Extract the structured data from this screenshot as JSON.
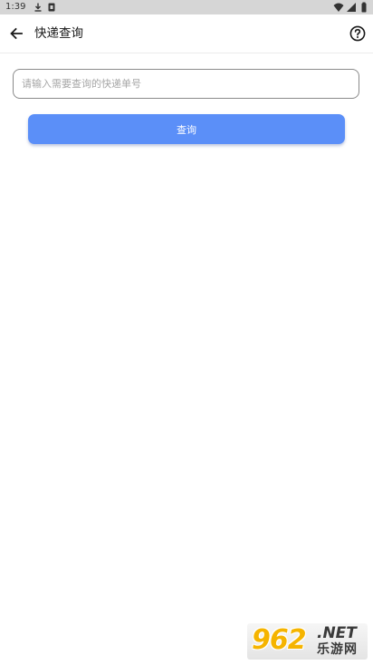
{
  "status_bar": {
    "time": "1:39",
    "icons": [
      "download-icon",
      "notification-box-icon",
      "wifi-icon",
      "cell-signal-icon",
      "battery-icon"
    ]
  },
  "app_bar": {
    "back_icon": "arrow-left-icon",
    "title": "快递查询",
    "help_icon": "question-circle-icon"
  },
  "search": {
    "placeholder": "请输入需要查询的快递单号",
    "value": ""
  },
  "query_button": {
    "label": "查询",
    "color": "#5b8ff8"
  },
  "watermark": {
    "number": "962",
    "domain": ".NET",
    "site": "乐游网"
  }
}
